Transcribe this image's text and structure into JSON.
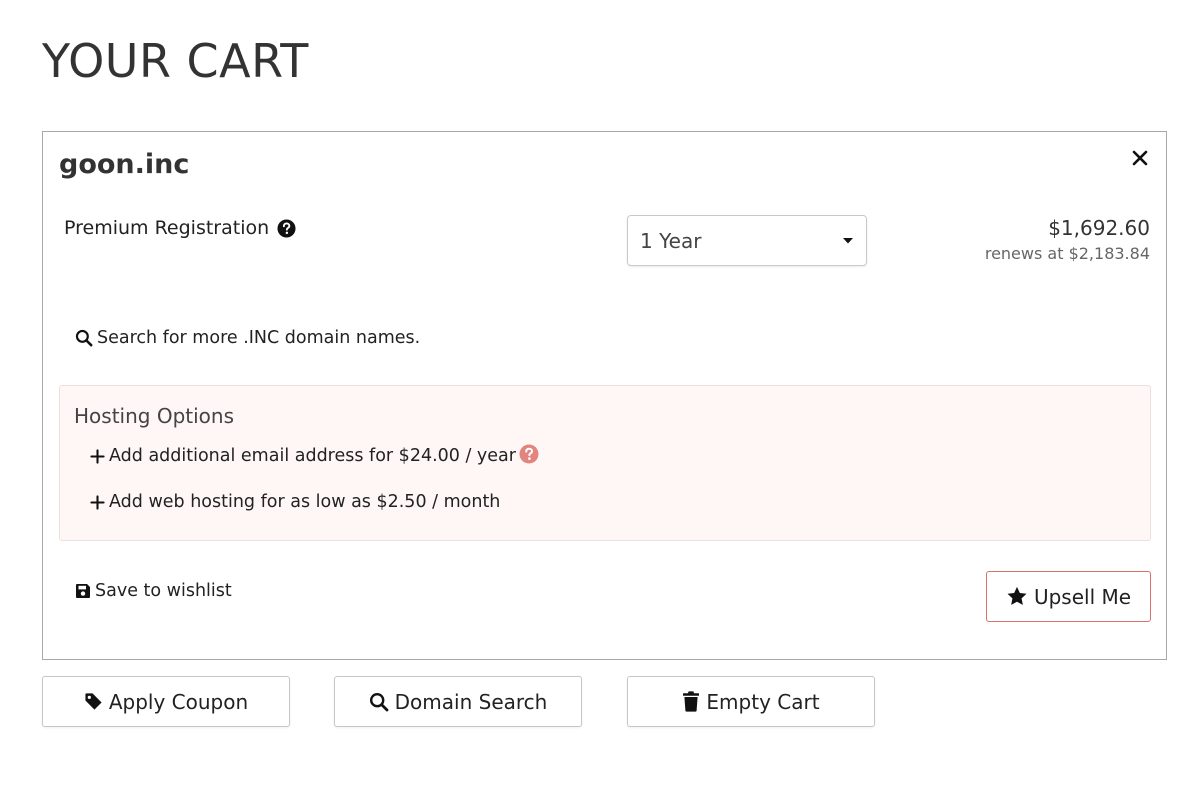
{
  "page": {
    "title": "YOUR CART"
  },
  "cart_item": {
    "domain": "goon.inc",
    "registration_label": "Premium Registration",
    "term_selected": "1 Year",
    "price": "$1,692.60",
    "renews": "renews at $2,183.84",
    "search_more": "Search for more .INC domain names.",
    "hosting": {
      "title": "Hosting Options",
      "email_option": "Add additional email address for $24.00 / year",
      "web_option": "Add web hosting for as low as $2.50 / month"
    },
    "save_wishlist": "Save to wishlist",
    "upsell": "Upsell Me"
  },
  "actions": {
    "apply_coupon": "Apply Coupon",
    "domain_search": "Domain Search",
    "empty_cart": "Empty Cart"
  },
  "icons": {
    "remove": "close-icon",
    "registration_help": "question-circle-icon",
    "term_dropdown": "caret-down-icon",
    "search": "search-icon",
    "add": "plus-icon",
    "email_help": "question-circle-icon",
    "wishlist": "floppy-disk-icon",
    "upsell": "star-icon",
    "coupon": "tag-icon",
    "empty_cart": "trash-icon"
  },
  "colors": {
    "hosting_bg": "#fff7f6",
    "upsell_border": "#d9716a",
    "help_accent": "#e2857e"
  }
}
